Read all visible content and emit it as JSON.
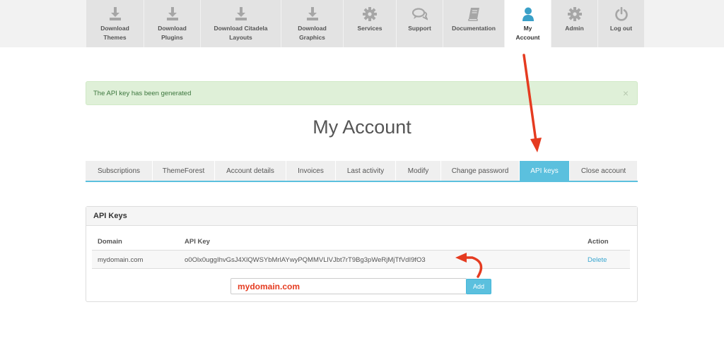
{
  "topnav": {
    "items": [
      {
        "label": "Download\nThemes",
        "icon": "download-icon"
      },
      {
        "label": "Download\nPlugins",
        "icon": "download-icon"
      },
      {
        "label": "Download Citadela\nLayouts",
        "icon": "download-icon"
      },
      {
        "label": "Download\nGraphics",
        "icon": "download-icon"
      },
      {
        "label": "Services",
        "icon": "gear-icon"
      },
      {
        "label": "Support",
        "icon": "chat-icon"
      },
      {
        "label": "Documentation",
        "icon": "book-icon"
      },
      {
        "label": "My\nAccount",
        "icon": "user-icon",
        "active": true
      },
      {
        "label": "Admin",
        "icon": "gear-icon"
      },
      {
        "label": "Log out",
        "icon": "power-icon"
      }
    ]
  },
  "alert": {
    "text": "The API key has been generated",
    "close": "×"
  },
  "page_title": "My Account",
  "tabs": [
    {
      "label": "Subscriptions"
    },
    {
      "label": "ThemeForest"
    },
    {
      "label": "Account details"
    },
    {
      "label": "Invoices"
    },
    {
      "label": "Last activity"
    },
    {
      "label": "Modify"
    },
    {
      "label": "Change password"
    },
    {
      "label": "API keys",
      "active": true
    },
    {
      "label": "Close account"
    }
  ],
  "panel": {
    "title": "API Keys",
    "columns": {
      "domain": "Domain",
      "api_key": "API Key",
      "action": "Action"
    },
    "rows": [
      {
        "domain": "mydomain.com",
        "api_key": "o0Olx0uggIhvGsJ4XlQWSYbMrlAYwyPQMMVLlVJbt7rT9Bg3pWeRjMjTfVdI9fO3",
        "action": "Delete"
      }
    ],
    "new_domain_value": "mydomain.com",
    "add_label": "Add"
  },
  "colors": {
    "accent": "#5bc0de",
    "annotation": "#e53b20",
    "success_bg": "#dff0d8"
  }
}
